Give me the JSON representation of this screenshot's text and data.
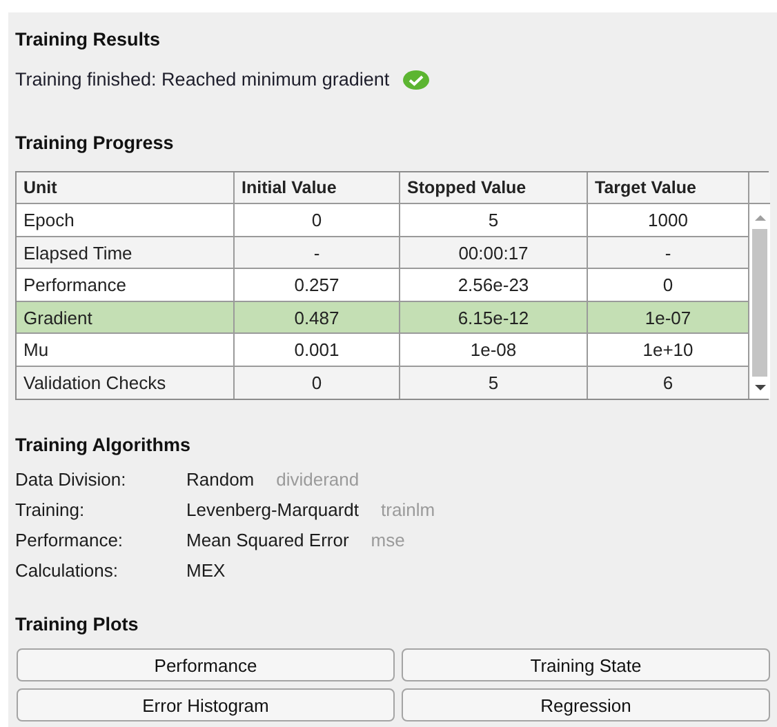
{
  "results": {
    "title": "Training Results",
    "status": "Training finished: Reached minimum gradient",
    "success": true
  },
  "progress": {
    "title": "Training Progress",
    "columns": [
      "Unit",
      "Initial Value",
      "Stopped Value",
      "Target Value"
    ],
    "rows": [
      {
        "cells": [
          "Epoch",
          "0",
          "5",
          "1000"
        ],
        "selected": false
      },
      {
        "cells": [
          "Elapsed Time",
          "-",
          "00:00:17",
          "-"
        ],
        "selected": false
      },
      {
        "cells": [
          "Performance",
          "0.257",
          "2.56e-23",
          "0"
        ],
        "selected": false
      },
      {
        "cells": [
          "Gradient",
          "0.487",
          "6.15e-12",
          "1e-07"
        ],
        "selected": true
      },
      {
        "cells": [
          "Mu",
          "0.001",
          "1e-08",
          "1e+10"
        ],
        "selected": false
      },
      {
        "cells": [
          "Validation Checks",
          "0",
          "5",
          "6"
        ],
        "selected": false
      }
    ]
  },
  "algorithms": {
    "title": "Training Algorithms",
    "items": [
      {
        "label": "Data Division:",
        "value": "Random",
        "function": "dividerand"
      },
      {
        "label": "Training:",
        "value": "Levenberg-Marquardt",
        "function": "trainlm"
      },
      {
        "label": "Performance:",
        "value": "Mean Squared Error",
        "function": "mse"
      },
      {
        "label": "Calculations:",
        "value": "MEX"
      }
    ]
  },
  "plots": {
    "title": "Training Plots",
    "buttons": [
      "Performance",
      "Training State",
      "Error Histogram",
      "Regression"
    ]
  }
}
